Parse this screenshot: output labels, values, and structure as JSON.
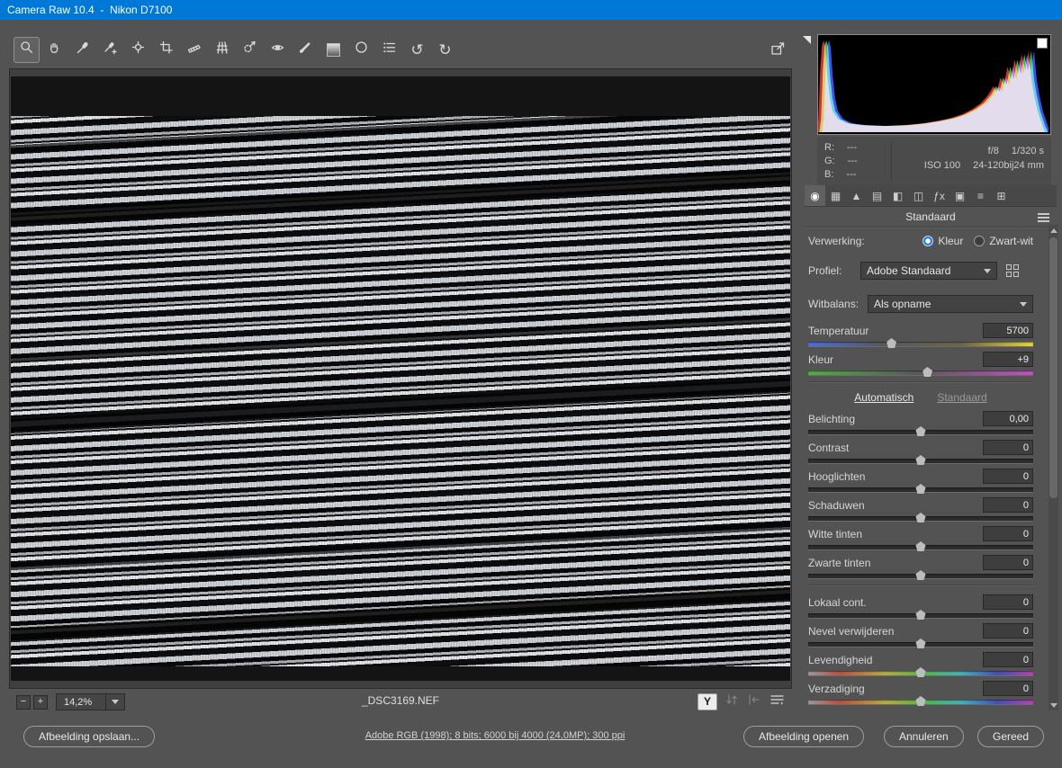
{
  "titlebar": {
    "title": "Camera Raw 10.4  -  Nikon D7100"
  },
  "toolbar": {
    "tools": [
      {
        "name": "zoom-tool"
      },
      {
        "name": "hand-tool"
      },
      {
        "name": "white-balance-tool"
      },
      {
        "name": "color-sampler-tool"
      },
      {
        "name": "targeted-adjustment-tool"
      },
      {
        "name": "crop-tool"
      },
      {
        "name": "straighten-tool"
      },
      {
        "name": "transform-tool"
      },
      {
        "name": "spot-removal-tool"
      },
      {
        "name": "red-eye-removal-tool"
      },
      {
        "name": "adjustment-brush-tool"
      },
      {
        "name": "graduated-filter-tool"
      },
      {
        "name": "radial-filter-tool"
      },
      {
        "name": "settings-list-tool"
      },
      {
        "name": "rotate-left-tool"
      },
      {
        "name": "rotate-right-tool"
      }
    ],
    "glyphs": {
      "rotate_left": "↺",
      "rotate_right": "↻"
    }
  },
  "preview": {
    "filename": "_DSC3169.NEF",
    "zoom": {
      "minus": "−",
      "plus": "+",
      "value": "14,2%"
    },
    "before_after": {
      "y_label": "Y"
    }
  },
  "histogram": {
    "rgb": [
      {
        "label": "R:",
        "value": "---"
      },
      {
        "label": "G:",
        "value": "---"
      },
      {
        "label": "B:",
        "value": "---"
      }
    ],
    "exif": {
      "aperture": "f/8",
      "shutter": "1/320 s",
      "iso": "ISO 100",
      "lens": "24-120bij24 mm"
    }
  },
  "panel": {
    "tabs": [
      {
        "name": "basic-tab",
        "glyph": "◉",
        "selected": true
      },
      {
        "name": "tone-curve-tab",
        "glyph": "▦"
      },
      {
        "name": "detail-tab",
        "glyph": "▲"
      },
      {
        "name": "hsl-grayscale-tab",
        "glyph": "▤"
      },
      {
        "name": "split-toning-tab",
        "glyph": "◧"
      },
      {
        "name": "lens-corrections-tab",
        "glyph": "◫"
      },
      {
        "name": "effects-tab",
        "glyph": "ƒx"
      },
      {
        "name": "camera-calibration-tab",
        "glyph": "▣"
      },
      {
        "name": "presets-tab",
        "glyph": "≡"
      },
      {
        "name": "snapshots-tab",
        "glyph": "⊞"
      }
    ],
    "title": "Standaard",
    "verwerking": {
      "label": "Verwerking:",
      "options": [
        {
          "label": "Kleur",
          "selected": true
        },
        {
          "label": "Zwart-wit",
          "selected": false
        }
      ]
    },
    "profiel": {
      "label": "Profiel:",
      "value": "Adobe Standaard"
    },
    "witbalans": {
      "label": "Witbalans:",
      "value": "Als opname"
    },
    "links": {
      "automatisch": "Automatisch",
      "standaard": "Standaard"
    },
    "sliders": [
      {
        "label": "Temperatuur",
        "value": "5700",
        "pos": 37,
        "type": "temp"
      },
      {
        "label": "Kleur",
        "value": "+9",
        "pos": 53,
        "type": "tint"
      },
      {
        "label": "Belichting",
        "value": "0,00",
        "pos": 50,
        "type": "plain"
      },
      {
        "label": "Contrast",
        "value": "0",
        "pos": 50,
        "type": "plain"
      },
      {
        "label": "Hooglichten",
        "value": "0",
        "pos": 50,
        "type": "plain"
      },
      {
        "label": "Schaduwen",
        "value": "0",
        "pos": 50,
        "type": "plain"
      },
      {
        "label": "Witte tinten",
        "value": "0",
        "pos": 50,
        "type": "plain"
      },
      {
        "label": "Zwarte tinten",
        "value": "0",
        "pos": 50,
        "type": "plain"
      },
      {
        "label": "Lokaal cont.",
        "value": "0",
        "pos": 50,
        "type": "plain"
      },
      {
        "label": "Nevel verwijderen",
        "value": "0",
        "pos": 50,
        "type": "plain"
      },
      {
        "label": "Levendigheid",
        "value": "0",
        "pos": 50,
        "type": "rainbow"
      },
      {
        "label": "Verzadiging",
        "value": "0",
        "pos": 50,
        "type": "rainbow"
      }
    ]
  },
  "bottombar": {
    "save": "Afbeelding opslaan...",
    "metadata_link": "Adobe RGB (1998); 8 bits; 6000 bij 4000 (24,0MP); 300 ppi",
    "open": "Afbeelding openen",
    "cancel": "Annuleren",
    "done": "Gereed"
  },
  "colors": {
    "titlebar": "#0078d7",
    "window_bg": "#535353",
    "radio_accent": "#2a7cd8",
    "temp_gradient_ends": [
      "#4a6ee0",
      "#e6d43e"
    ],
    "tint_gradient_ends": [
      "#4fae43",
      "#c44fc0"
    ]
  }
}
